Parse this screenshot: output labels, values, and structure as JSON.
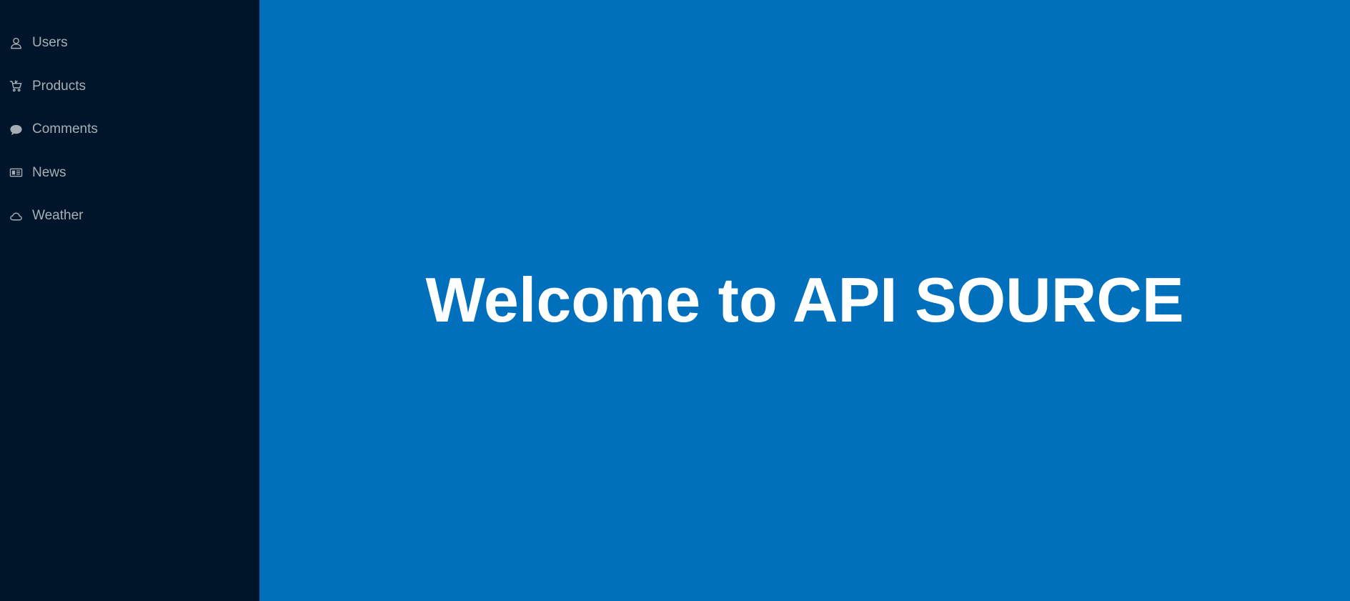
{
  "sidebar": {
    "items": [
      {
        "label": "Users",
        "icon": "user-icon"
      },
      {
        "label": "Products",
        "icon": "shopping-cart-icon"
      },
      {
        "label": "Comments",
        "icon": "comment-icon"
      },
      {
        "label": "News",
        "icon": "newspaper-icon"
      },
      {
        "label": "Weather",
        "icon": "cloud-icon"
      }
    ]
  },
  "main": {
    "heading": "Welcome to API SOURCE"
  },
  "colors": {
    "sidebar_bg": "#001529",
    "main_bg": "#0070bd",
    "nav_text": "#a6adb4",
    "heading": "#ffffff"
  }
}
